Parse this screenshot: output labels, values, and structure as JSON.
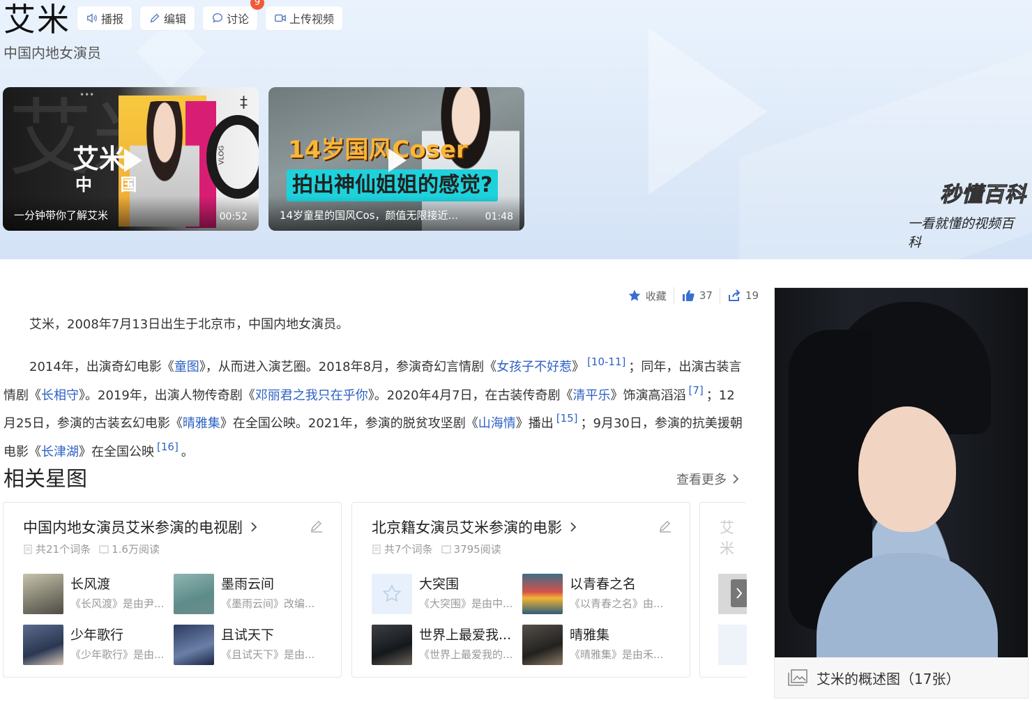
{
  "hero": {
    "title": "艾米",
    "subtitle": "中国内地女演员",
    "tools": {
      "broadcast": "播报",
      "edit": "编辑",
      "discuss": "讨论",
      "discuss_badge": "9",
      "upload": "上传视频"
    },
    "videos": [
      {
        "overlay_title": "艾米",
        "overlay_sub": "中 国",
        "caption": "一分钟带你了解艾米",
        "duration": "00:52"
      },
      {
        "overlay_line1": "14岁国风Coser",
        "overlay_line2_a": "拍出",
        "overlay_line2_hl": "神仙姐姐",
        "overlay_line2_b": "的感觉?",
        "caption": "14岁童星的国风Cos，颜值无限接近...",
        "duration": "01:48"
      }
    ],
    "brand": {
      "logo": "秒懂百科",
      "slogan": "一看就懂的视频百科"
    }
  },
  "actions": {
    "collect": "收藏",
    "likes": "37",
    "shares": "19"
  },
  "intro": {
    "p1": "艾米，2008年7月13日出生于北京市，中国内地女演员。",
    "p2": {
      "s1": "2014年，出演奇幻电影《",
      "l1": "童图",
      "s2": "》，从而进入演艺圈。2018年8月，参演奇幻言情剧《",
      "l2": "女孩子不好惹",
      "s3": "》",
      "r1": "[10-11]",
      "s4": "；同年，出演古装言情剧《",
      "l3": "长相守",
      "s5": "》。2019年，出演人物传奇剧《",
      "l4": "邓丽君之我只在乎你",
      "s6": "》。2020年4月7日，在古装传奇剧《",
      "l5": "清平乐",
      "s7": "》饰演高滔滔",
      "r2": "[7]",
      "s8": "；12月25日，参演的古装玄幻电影《",
      "l6": "晴雅集",
      "s9": "》在全国公映。2021年，参演的脱贫攻坚剧《",
      "l7": "山海情",
      "s10": "》播出",
      "r3": "[15]",
      "s11": "；9月30日，参演的抗美援朝电影《",
      "l8": "长津湖",
      "s12": "》在全国公映",
      "r4": "[16]",
      "s13": "。"
    }
  },
  "related": {
    "title": "相关星图",
    "more": "查看更多",
    "cards": [
      {
        "title": "中国内地女演员艾米参演的电视剧",
        "count": "共21个词条",
        "reads": "1.6万阅读",
        "entries": [
          {
            "name": "长风渡",
            "desc": "《长风渡》是由尹..."
          },
          {
            "name": "墨雨云间",
            "desc": "《墨雨云间》改编..."
          },
          {
            "name": "少年歌行",
            "desc": "《少年歌行》是由..."
          },
          {
            "name": "且试天下",
            "desc": "《且试天下》是由..."
          }
        ]
      },
      {
        "title": "北京籍女演员艾米参演的电影",
        "count": "共7个词条",
        "reads": "3795阅读",
        "entries": [
          {
            "name": "大突围",
            "desc": "《大突围》是由中..."
          },
          {
            "name": "以青春之名",
            "desc": "《以青春之名》由..."
          },
          {
            "name": "世界上最爱我...",
            "desc": "《世界上最爱我的..."
          },
          {
            "name": "晴雅集",
            "desc": "《晴雅集》是由禾..."
          }
        ]
      },
      {
        "title": "艾米"
      }
    ]
  },
  "photo": {
    "caption": "艾米的概述图（17张）"
  }
}
